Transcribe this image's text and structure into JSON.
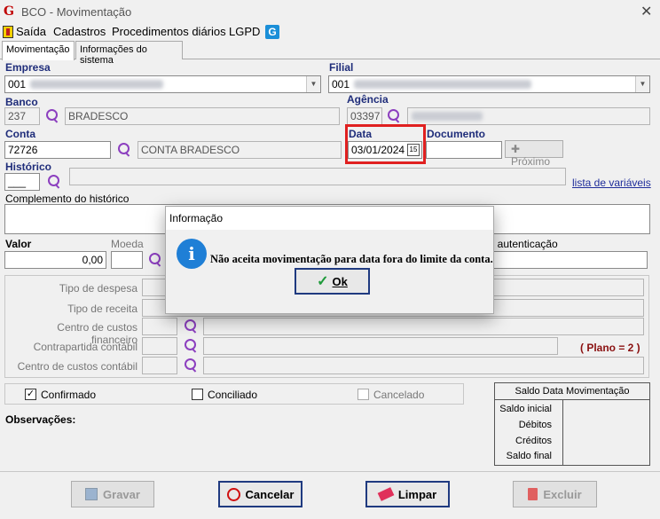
{
  "window": {
    "title": "BCO - Movimentação",
    "app_icon": "G",
    "close": "✕"
  },
  "menu": {
    "items": [
      "Saída",
      "Cadastros",
      "Procedimentos diários",
      "LGPD"
    ],
    "g_badge": "G"
  },
  "tabs": [
    "Movimentação",
    "Informações do sistema"
  ],
  "empresa": {
    "label": "Empresa",
    "value": "001"
  },
  "filial": {
    "label": "Filial",
    "value": "001"
  },
  "banco": {
    "label": "Banco",
    "code": "237",
    "name": "BRADESCO"
  },
  "agencia": {
    "label": "Agência",
    "code": "03397"
  },
  "conta": {
    "label": "Conta",
    "code": "72726",
    "name": "CONTA BRADESCO"
  },
  "data": {
    "label": "Data",
    "value": "03/01/2024",
    "calendar_glyph": "15"
  },
  "documento": {
    "label": "Documento",
    "value": "",
    "next_label": "Próximo"
  },
  "historico": {
    "label": "Histórico",
    "code": "___",
    "vars_link": "lista de variáveis"
  },
  "complemento": {
    "label": "Complemento do histórico"
  },
  "valor": {
    "label": "Valor",
    "value": "0,00"
  },
  "moeda": {
    "label": "Moeda"
  },
  "autenticacao": {
    "label": "ero autenticação"
  },
  "classificacao": {
    "tipo_despesa": "Tipo de despesa",
    "tipo_receita": "Tipo de receita",
    "centro_financeiro": "Centro de custos financeiro",
    "contrapartida": "Contrapartida contábil",
    "centro_contabil": "Centro de custos contábil",
    "plano": "( Plano = 2 )"
  },
  "status": {
    "confirmado": "Confirmado",
    "conciliado": "Conciliado",
    "cancelado": "Cancelado",
    "check": "✓"
  },
  "saldo": {
    "title": "Saldo Data Movimentação",
    "rows": [
      "Saldo inicial",
      "Débitos",
      "Créditos",
      "Saldo final"
    ]
  },
  "observacoes": {
    "label": "Observações:"
  },
  "buttons": {
    "gravar": "Gravar",
    "cancelar": "Cancelar",
    "limpar": "Limpar",
    "excluir": "Excluir"
  },
  "dialog": {
    "title": "Informação",
    "icon": "i",
    "message": "Não aceita movimentação para data fora do limite da conta.",
    "ok_label": "Ok"
  },
  "colors": {
    "highlight": "#e02020",
    "label_blue": "#1f2d7a",
    "search_purple": "#8c3fbf",
    "plano_red": "#8a1010"
  }
}
